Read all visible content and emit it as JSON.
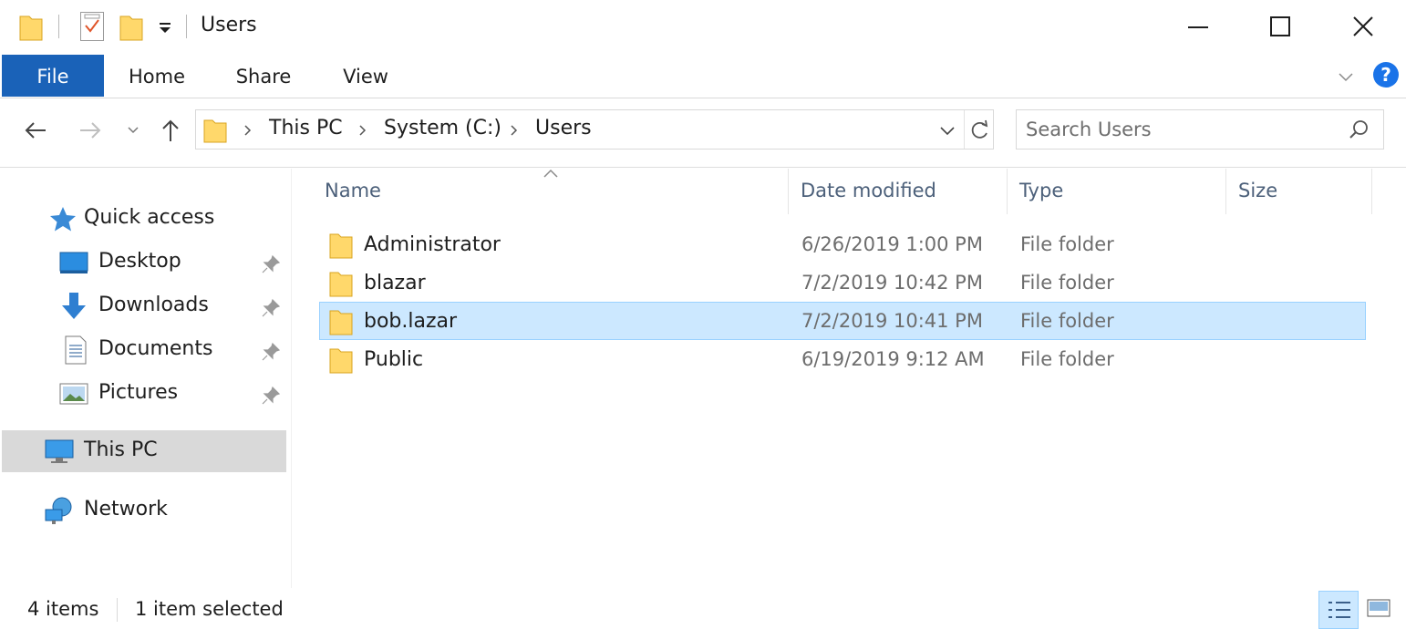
{
  "window": {
    "title": "Users",
    "minimize_icon": "minimize-icon",
    "maximize_icon": "maximize-icon",
    "close_icon": "close-icon"
  },
  "quick_access_toolbar": {
    "icons": [
      "folder-icon",
      "properties-icon",
      "new-folder-icon",
      "customize-dropdown-icon"
    ]
  },
  "ribbon": {
    "tabs": [
      {
        "label": "File",
        "active": true
      },
      {
        "label": "Home"
      },
      {
        "label": "Share"
      },
      {
        "label": "View"
      }
    ],
    "accent_color": "#1a62b8",
    "help_label": "?"
  },
  "navigation": {
    "breadcrumbs": [
      "This PC",
      "System (C:)",
      "Users"
    ],
    "search": {
      "placeholder": "Search Users",
      "value": ""
    }
  },
  "sidebar": {
    "items": [
      {
        "label": "Quick access",
        "icon": "star-icon"
      },
      {
        "label": "Desktop",
        "icon": "desktop-icon",
        "pinned": true
      },
      {
        "label": "Downloads",
        "icon": "download-arrow-icon",
        "pinned": true
      },
      {
        "label": "Documents",
        "icon": "document-icon",
        "pinned": true
      },
      {
        "label": "Pictures",
        "icon": "pictures-icon",
        "pinned": true
      },
      {
        "label": "This PC",
        "icon": "computer-icon",
        "selected": true
      },
      {
        "label": "Network",
        "icon": "network-icon"
      }
    ]
  },
  "columns": {
    "name": "Name",
    "date": "Date modified",
    "type": "Type",
    "size": "Size"
  },
  "files": [
    {
      "name": "Administrator",
      "date": "6/26/2019 1:00 PM",
      "type": "File folder",
      "size": ""
    },
    {
      "name": "blazar",
      "date": "7/2/2019 10:42 PM",
      "type": "File folder",
      "size": ""
    },
    {
      "name": "bob.lazar",
      "date": "7/2/2019 10:41 PM",
      "type": "File folder",
      "size": "",
      "selected": true
    },
    {
      "name": "Public",
      "date": "6/19/2019 9:12 AM",
      "type": "File folder",
      "size": ""
    }
  ],
  "status": {
    "count": "4 items",
    "selection": "1 item selected"
  },
  "colors": {
    "selection_bg": "#cce8ff",
    "selection_border": "#99d1ff",
    "folder_yellow": "#ffd86b"
  }
}
